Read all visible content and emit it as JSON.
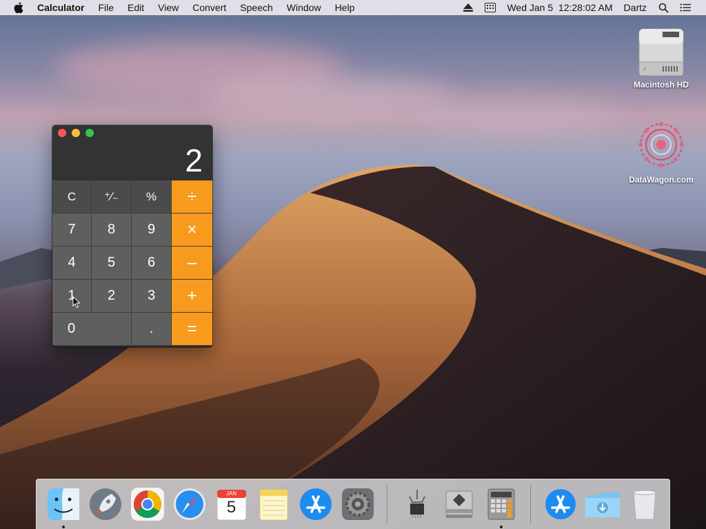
{
  "menubar": {
    "app_name": "Calculator",
    "menus": [
      "File",
      "Edit",
      "View",
      "Convert",
      "Speech",
      "Window",
      "Help"
    ],
    "datetime": "Wed Jan 5  12:28:02 AM",
    "user": "Dartz",
    "icons": [
      "apple-icon",
      "eject-icon",
      "keyboard-icon",
      "search-icon",
      "list-icon"
    ]
  },
  "desktop": {
    "icons": [
      {
        "label": "Macintosh HD",
        "icon": "hard-drive-icon"
      },
      {
        "label": "DataWagon.com",
        "icon": "datawagon-icon"
      }
    ]
  },
  "calculator": {
    "display": "2",
    "keys": [
      {
        "label": "C",
        "type": "fn"
      },
      {
        "label": "⁺∕₋",
        "type": "fn"
      },
      {
        "label": "%",
        "type": "fn"
      },
      {
        "label": "÷",
        "type": "op"
      },
      {
        "label": "7",
        "type": "num"
      },
      {
        "label": "8",
        "type": "num"
      },
      {
        "label": "9",
        "type": "num"
      },
      {
        "label": "×",
        "type": "op"
      },
      {
        "label": "4",
        "type": "num"
      },
      {
        "label": "5",
        "type": "num"
      },
      {
        "label": "6",
        "type": "num"
      },
      {
        "label": "–",
        "type": "op"
      },
      {
        "label": "1",
        "type": "num"
      },
      {
        "label": "2",
        "type": "num"
      },
      {
        "label": "3",
        "type": "num"
      },
      {
        "label": "+",
        "type": "op"
      },
      {
        "label": "0",
        "type": "zero"
      },
      {
        "label": ".",
        "type": "num"
      },
      {
        "label": "=",
        "type": "op"
      }
    ],
    "colors": {
      "operator": "#f69b1e",
      "number": "#5f5f5f",
      "function": "#4b4b4b"
    }
  },
  "dock": {
    "apps": [
      {
        "name": "finder-icon",
        "running": true
      },
      {
        "name": "launchpad-icon",
        "running": false
      },
      {
        "name": "chrome-icon",
        "running": false
      },
      {
        "name": "safari-icon",
        "running": false
      },
      {
        "name": "calendar-icon",
        "running": false,
        "month": "JAN",
        "day": "5"
      },
      {
        "name": "notes-icon",
        "running": false
      },
      {
        "name": "app-store-icon",
        "running": false
      },
      {
        "name": "system-preferences-icon",
        "running": false
      },
      {
        "name": "separator"
      },
      {
        "name": "usb-icon",
        "running": false
      },
      {
        "name": "boot-camp-icon",
        "running": false
      },
      {
        "name": "calculator-icon",
        "running": true
      },
      {
        "name": "separator"
      },
      {
        "name": "applications-folder-icon",
        "running": false
      },
      {
        "name": "downloads-folder-icon",
        "running": false
      },
      {
        "name": "trash-icon",
        "running": false
      }
    ]
  }
}
